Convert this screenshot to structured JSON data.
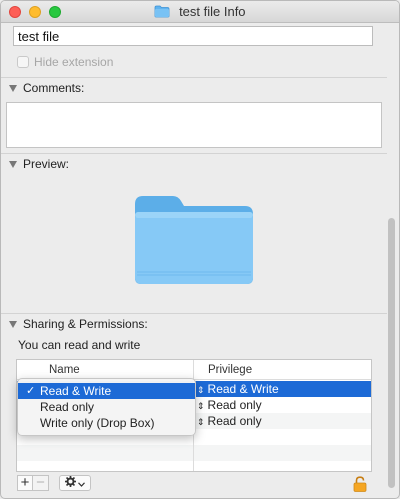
{
  "window": {
    "title": "test file Info"
  },
  "name_field": {
    "value": "test file"
  },
  "hide_extension": {
    "label": "Hide extension",
    "checked": false
  },
  "sections": {
    "comments": "Comments:",
    "preview": "Preview:",
    "sharing": "Sharing & Permissions:"
  },
  "permissions": {
    "summary": "You can read and write",
    "columns": [
      "Name",
      "Privilege"
    ],
    "rows": [
      {
        "privilege": "Read & Write",
        "selected": true
      },
      {
        "privilege": "Read only",
        "selected": false
      },
      {
        "privilege": "Read only",
        "selected": false
      }
    ]
  },
  "privilege_menu": {
    "items": [
      "Read & Write",
      "Read only",
      "Write only (Drop Box)"
    ],
    "checked": "Read & Write",
    "check_glyph": "✓"
  },
  "bottom_bar": {
    "add": "+",
    "remove": "−",
    "icons": [
      "gear-icon",
      "chevron-down-icon",
      "lock-icon"
    ]
  },
  "colors": {
    "selection": "#1d6ad6",
    "folder": "#7dc3f5",
    "lock": "#f5a623"
  }
}
